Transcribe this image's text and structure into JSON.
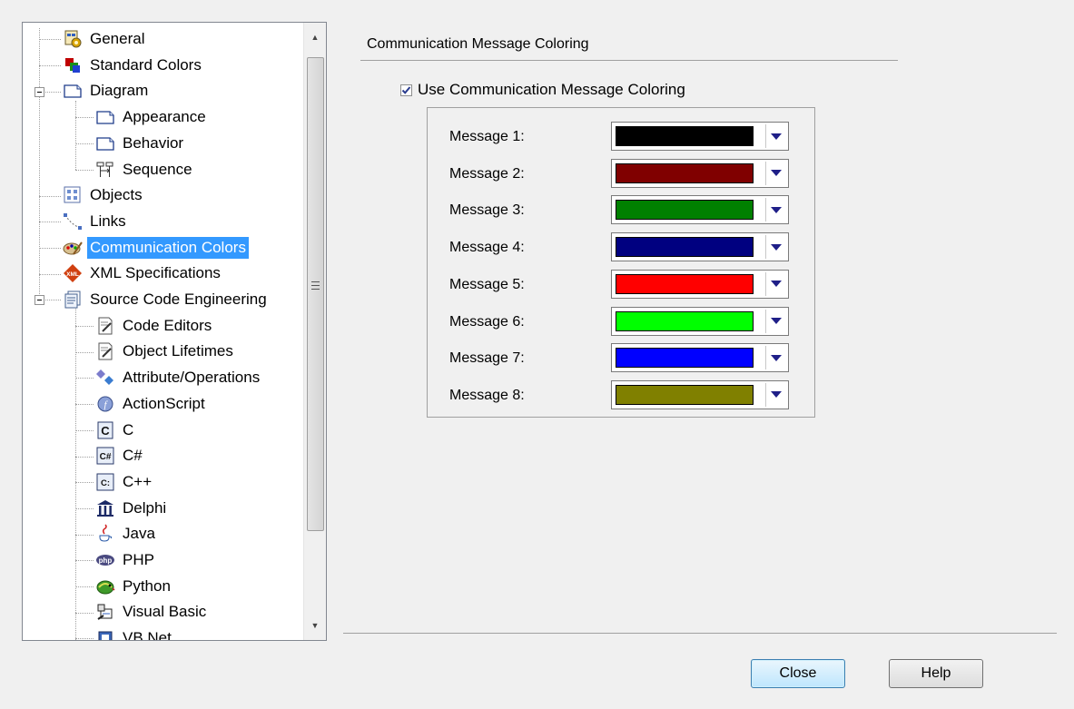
{
  "tree": {
    "items": [
      {
        "label": "General",
        "icon": "general-icon",
        "level": 1
      },
      {
        "label": "Standard Colors",
        "icon": "standard-colors-icon",
        "level": 1
      },
      {
        "label": "Diagram",
        "icon": "diagram-icon",
        "level": 1,
        "expanded": true
      },
      {
        "label": "Appearance",
        "icon": "diagram-page-icon",
        "level": 2
      },
      {
        "label": "Behavior",
        "icon": "diagram-page-icon",
        "level": 2
      },
      {
        "label": "Sequence",
        "icon": "sequence-icon",
        "level": 2
      },
      {
        "label": "Objects",
        "icon": "objects-icon",
        "level": 1
      },
      {
        "label": "Links",
        "icon": "links-icon",
        "level": 1
      },
      {
        "label": "Communication Colors",
        "icon": "palette-icon",
        "level": 1,
        "selected": true
      },
      {
        "label": "XML Specifications",
        "icon": "xml-icon",
        "level": 1
      },
      {
        "label": "Source Code Engineering",
        "icon": "source-code-icon",
        "level": 1,
        "expanded": true
      },
      {
        "label": "Code Editors",
        "icon": "code-page-icon",
        "level": 2
      },
      {
        "label": "Object Lifetimes",
        "icon": "code-page-icon",
        "level": 2
      },
      {
        "label": "Attribute/Operations",
        "icon": "attribute-operations-icon",
        "level": 2
      },
      {
        "label": "ActionScript",
        "icon": "actionscript-icon",
        "level": 2
      },
      {
        "label": "C",
        "icon": "c-language-icon",
        "level": 2
      },
      {
        "label": "C#",
        "icon": "csharp-icon",
        "level": 2
      },
      {
        "label": "C++",
        "icon": "cpp-icon",
        "level": 2
      },
      {
        "label": "Delphi",
        "icon": "delphi-icon",
        "level": 2
      },
      {
        "label": "Java",
        "icon": "java-icon",
        "level": 2
      },
      {
        "label": "PHP",
        "icon": "php-icon",
        "level": 2
      },
      {
        "label": "Python",
        "icon": "python-icon",
        "level": 2
      },
      {
        "label": "Visual Basic",
        "icon": "visual-basic-icon",
        "level": 2
      },
      {
        "label": "VB.Net",
        "icon": "vbnet-icon",
        "level": 2
      }
    ]
  },
  "section": {
    "title": "Communication Message Coloring",
    "use_label": "Use Communication Message Coloring",
    "use_checked": true
  },
  "messages": [
    {
      "label": "Message 1:",
      "color": "#000000"
    },
    {
      "label": "Message 2:",
      "color": "#800000"
    },
    {
      "label": "Message 3:",
      "color": "#008000"
    },
    {
      "label": "Message 4:",
      "color": "#000080"
    },
    {
      "label": "Message 5:",
      "color": "#ff0000"
    },
    {
      "label": "Message 6:",
      "color": "#00ff00"
    },
    {
      "label": "Message 7:",
      "color": "#0000ff"
    },
    {
      "label": "Message 8:",
      "color": "#808000"
    }
  ],
  "buttons": {
    "close_label": "Close",
    "help_label": "Help"
  },
  "colors": {
    "selection": "#3399ff",
    "dropdown_arrow": "#1f1f88"
  }
}
